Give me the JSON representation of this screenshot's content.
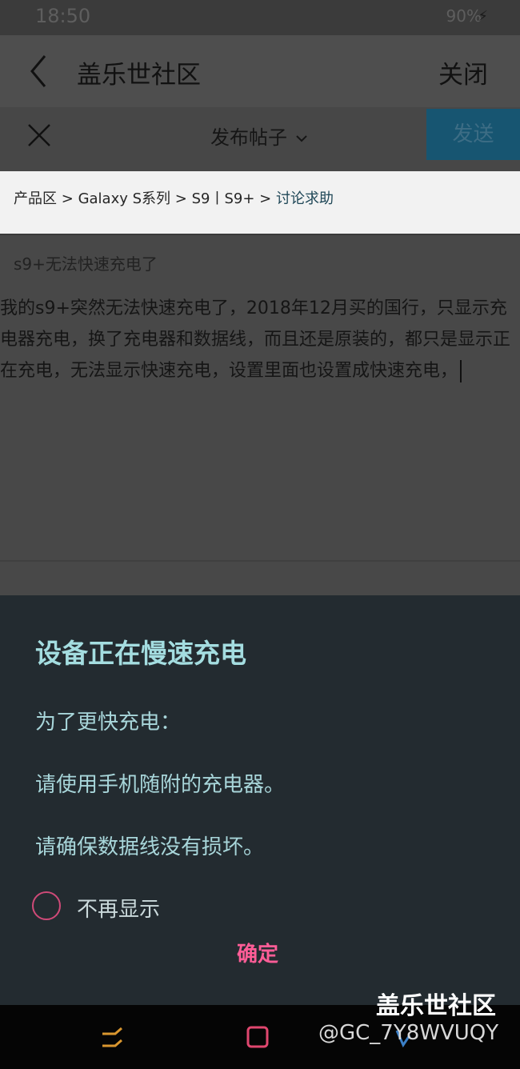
{
  "status_bar": {
    "time": "18:50",
    "battery": "90%",
    "icons": [
      "wifi-icon",
      "signal-icon",
      "battery-icon",
      "charging-icon"
    ]
  },
  "header": {
    "title": "盖乐世社区",
    "close_label": "关闭",
    "icons": [
      "back-chevron-icon"
    ]
  },
  "compose": {
    "post_type": "发布帖子",
    "post_type_icon": "chevron-down-icon",
    "send_label": "发送",
    "accent_color": "#175571"
  },
  "breadcrumb": {
    "items": [
      "产品区",
      "Galaxy S系列",
      "S9丨S9+"
    ],
    "separator": ">",
    "current": "讨论求助"
  },
  "post": {
    "title": "s9+无法快速充电了",
    "body": "我的s9+突然无法快速充电了，2018年12月买的国行，只显示充电器充电，换了充电器和数据线，而且还是原装的，都只是显示正在充电，无法显示快速充电，设置里面也设置成快速充电，"
  },
  "dialog": {
    "title": "设备正在慢速充电",
    "line1": "为了更快充电：",
    "line2": "请使用手机随附的充电器。",
    "line3": "请确保数据线没有损坏。",
    "checkbox_label": "不再显示",
    "ok_label": "确定",
    "colors": {
      "background": "#232b30",
      "title": "#a4dde0",
      "accent": "#ff5d97"
    }
  },
  "watermark": {
    "brand": "盖乐世社区",
    "user": "@GC_7Y8WVUQY"
  }
}
